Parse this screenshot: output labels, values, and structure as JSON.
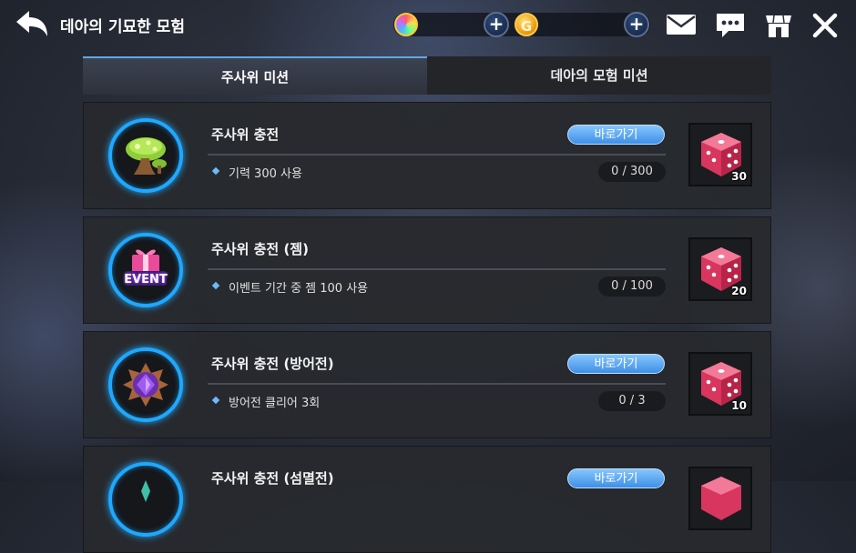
{
  "header": {
    "title": "데아의 기묘한 모험",
    "plus_label": "+",
    "gold_letter": "G"
  },
  "tabs": [
    {
      "label": "주사위 미션",
      "active": true
    },
    {
      "label": "데아의 모험 미션",
      "active": false
    }
  ],
  "missions": [
    {
      "title": "주사위 충전",
      "desc": "기력 300 사용",
      "progress": "0 / 300",
      "goto_label": "바로가기",
      "reward_count": "30",
      "icon": "mushroom-icon"
    },
    {
      "title": "주사위 충전 (젬)",
      "desc": "이벤트 기간 중 젬 100 사용",
      "progress": "0 / 100",
      "goto_label": "",
      "reward_count": "20",
      "icon": "event-gift-icon",
      "icon_text": "EVENT"
    },
    {
      "title": "주사위 충전 (방어전)",
      "desc": "방어전 클리어 3회",
      "progress": "0 / 3",
      "goto_label": "바로가기",
      "reward_count": "10",
      "icon": "purple-gem-emblem-icon"
    },
    {
      "title": "주사위 충전 (섬멸전)",
      "desc": "",
      "progress": "",
      "goto_label": "바로가기",
      "reward_count": "",
      "icon": "emblem-icon"
    }
  ],
  "colors": {
    "accent": "#1ea8ff",
    "goto_button": "#5aa8f2",
    "dice": "#e8456e"
  }
}
